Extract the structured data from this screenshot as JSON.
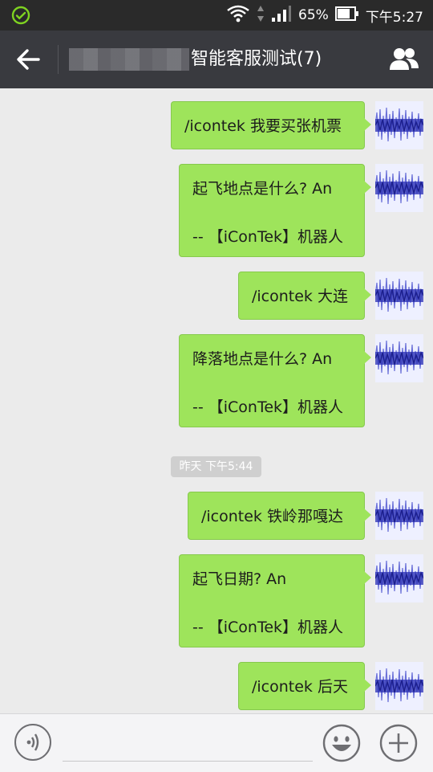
{
  "status_bar": {
    "battery_percent": "65%",
    "time": "下午5:27"
  },
  "header": {
    "title": "智能客服测试(7)"
  },
  "colors": {
    "bubble_green": "#9ee45b",
    "header_bg": "#393a3f",
    "chat_bg": "#ebebeb"
  },
  "messages": [
    {
      "line1": "/icontek 我要买张机票"
    },
    {
      "line1": "起飞地点是什么? An",
      "line2": "-- 【iConTek】机器人"
    },
    {
      "line1": "/icontek 大连"
    },
    {
      "line1": "降落地点是什么? An",
      "line2": "-- 【iConTek】机器人"
    },
    {
      "line1": "/icontek 铁岭那嘎达"
    },
    {
      "line1": "起飞日期? An",
      "line2": "-- 【iConTek】机器人"
    },
    {
      "line1": "/icontek 后天"
    }
  ],
  "timestamp": "昨天 下午5:44",
  "icons": [
    "check-circle-icon",
    "wifi-icon",
    "signal-icon",
    "battery-icon",
    "back-arrow-icon",
    "group-icon",
    "voice-icon",
    "emoji-icon",
    "plus-icon"
  ]
}
